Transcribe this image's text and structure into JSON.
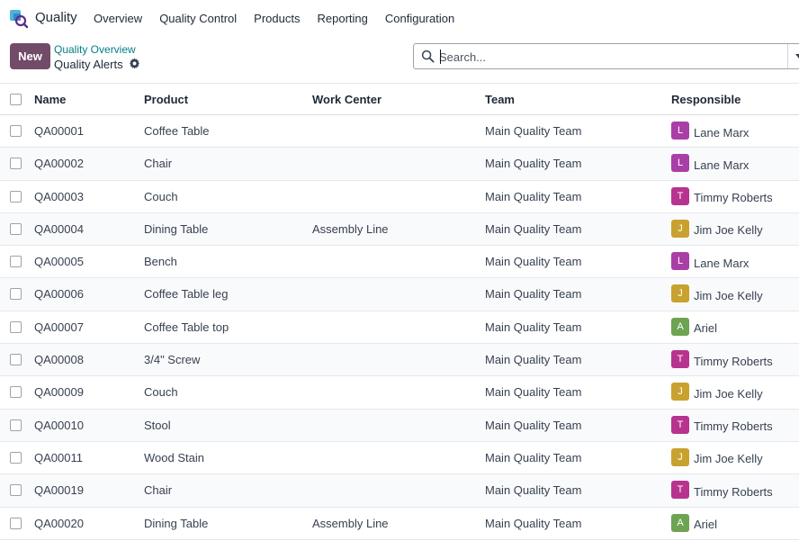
{
  "navbar": {
    "app_name": "Quality",
    "menu": [
      "Overview",
      "Quality Control",
      "Products",
      "Reporting",
      "Configuration"
    ]
  },
  "control_panel": {
    "new_label": "New",
    "breadcrumb": "Quality Overview",
    "title": "Quality Alerts"
  },
  "search": {
    "placeholder": "Search..."
  },
  "table": {
    "headers": {
      "name": "Name",
      "product": "Product",
      "work_center": "Work Center",
      "team": "Team",
      "responsible": "Responsible"
    },
    "rows": [
      {
        "name": "QA00001",
        "product": "Coffee Table",
        "work_center": "",
        "team": "Main Quality Team",
        "initial": "L",
        "responsible": "Lane Marx"
      },
      {
        "name": "QA00002",
        "product": "Chair",
        "work_center": "",
        "team": "Main Quality Team",
        "initial": "L",
        "responsible": "Lane Marx"
      },
      {
        "name": "QA00003",
        "product": "Couch",
        "work_center": "",
        "team": "Main Quality Team",
        "initial": "T",
        "responsible": "Timmy Roberts"
      },
      {
        "name": "QA00004",
        "product": "Dining Table",
        "work_center": "Assembly Line",
        "team": "Main Quality Team",
        "initial": "J",
        "responsible": "Jim Joe Kelly"
      },
      {
        "name": "QA00005",
        "product": "Bench",
        "work_center": "",
        "team": "Main Quality Team",
        "initial": "L",
        "responsible": "Lane Marx"
      },
      {
        "name": "QA00006",
        "product": "Coffee Table leg",
        "work_center": "",
        "team": "Main Quality Team",
        "initial": "J",
        "responsible": "Jim Joe Kelly"
      },
      {
        "name": "QA00007",
        "product": "Coffee Table top",
        "work_center": "",
        "team": "Main Quality Team",
        "initial": "A",
        "responsible": "Ariel"
      },
      {
        "name": "QA00008",
        "product": "3/4\" Screw",
        "work_center": "",
        "team": "Main Quality Team",
        "initial": "T",
        "responsible": "Timmy Roberts"
      },
      {
        "name": "QA00009",
        "product": "Couch",
        "work_center": "",
        "team": "Main Quality Team",
        "initial": "J",
        "responsible": "Jim Joe Kelly"
      },
      {
        "name": "QA00010",
        "product": "Stool",
        "work_center": "",
        "team": "Main Quality Team",
        "initial": "T",
        "responsible": "Timmy Roberts"
      },
      {
        "name": "QA00011",
        "product": "Wood Stain",
        "work_center": "",
        "team": "Main Quality Team",
        "initial": "J",
        "responsible": "Jim Joe Kelly"
      },
      {
        "name": "QA00019",
        "product": "Chair",
        "work_center": "",
        "team": "Main Quality Team",
        "initial": "T",
        "responsible": "Timmy Roberts"
      },
      {
        "name": "QA00020",
        "product": "Dining Table",
        "work_center": "Assembly Line",
        "team": "Main Quality Team",
        "initial": "A",
        "responsible": "Ariel"
      }
    ]
  },
  "colors": {
    "primary": "#714b67",
    "link": "#017e84",
    "avatar_L": "#a93fa6",
    "avatar_T": "#b7338f",
    "avatar_J": "#c9a12f",
    "avatar_A": "#6ea352"
  },
  "icons": {
    "app": "quality-app-icon",
    "gear": "gear-icon",
    "search": "search-icon",
    "toggle": "caret-down-icon"
  }
}
